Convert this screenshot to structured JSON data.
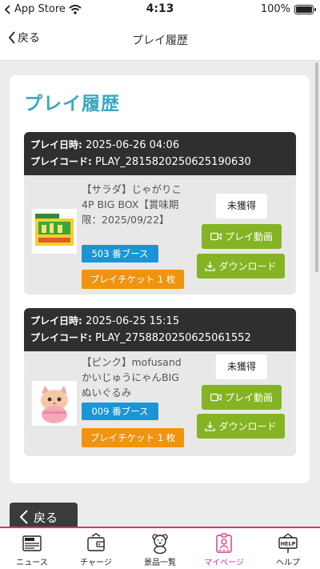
{
  "status_bar": {
    "carrier": "App Store",
    "time": "4:13",
    "battery": "100%"
  },
  "nav": {
    "back_label": "戻る",
    "title": "プレイ履歴"
  },
  "page": {
    "heading": "プレイ履歴"
  },
  "records": [
    {
      "date_label": "プレイ日時:",
      "date_value": "2025-06-26 04:06",
      "code_label": "プレイコード:",
      "code_value": "PLAY_2815820250625190630",
      "prize_name": "【サラダ】じゃがりこ4P BIG BOX【賞味期限：2025/09/22】",
      "booth": "503 番ブース",
      "ticket": "プレイチケット 1 枚",
      "status": "未獲得",
      "video_label": "プレイ動画",
      "download_label": "ダウンロード",
      "thumb_icon": "snack-box-icon"
    },
    {
      "date_label": "プレイ日時:",
      "date_value": "2025-06-25 15:15",
      "code_label": "プレイコード:",
      "code_value": "PLAY_2758820250625061552",
      "prize_name": "【ピンク】mofusand かいじゅうにゃんBIGぬいぐるみ",
      "booth": "009 番ブース",
      "ticket": "プレイチケット 1 枚",
      "status": "未獲得",
      "video_label": "プレイ動画",
      "download_label": "ダウンロード",
      "thumb_icon": "plush-cat-icon"
    }
  ],
  "back_bottom_label": "戻る",
  "tabs": [
    {
      "label": "ニュース",
      "icon": "newspaper-icon"
    },
    {
      "label": "チャージ",
      "icon": "wallet-icon"
    },
    {
      "label": "景品一覧",
      "icon": "bear-icon"
    },
    {
      "label": "マイページ",
      "icon": "profile-card-icon",
      "active": true
    },
    {
      "label": "ヘルプ",
      "icon": "help-sign-icon"
    }
  ],
  "colors": {
    "accent": "#3aa8bf",
    "booth": "#1b95d6",
    "ticket": "#f0940f",
    "action": "#84b423",
    "tab_active": "#d63384"
  }
}
